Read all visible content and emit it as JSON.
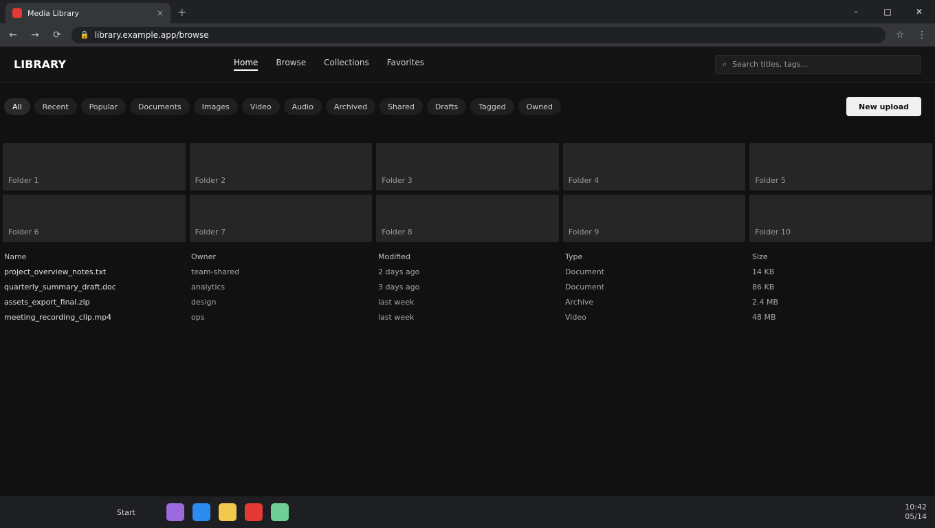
{
  "browser": {
    "tab_title": "Media Library",
    "tab_close": "×",
    "new_tab": "+",
    "win_min": "–",
    "win_max": "□",
    "win_close": "✕",
    "back": "←",
    "forward": "→",
    "reload": "⟳",
    "lock": "🔒",
    "url": "library.example.app/browse",
    "ext_star": "☆",
    "ext_menu": "⋮"
  },
  "app": {
    "logo": "LIBRARY",
    "nav": [
      "Home",
      "Browse",
      "Collections",
      "Favorites"
    ],
    "search_placeholder": "Search titles, tags…",
    "search_icon": "⌕"
  },
  "filters": {
    "chips": [
      "All",
      "Recent",
      "Popular",
      "Documents",
      "Images",
      "Video",
      "Audio",
      "Archived",
      "Shared",
      "Drafts",
      "Tagged",
      "Owned"
    ],
    "primary_button": "New upload"
  },
  "tiles": [
    {
      "label": "Folder 1"
    },
    {
      "label": "Folder 2"
    },
    {
      "label": "Folder 3"
    },
    {
      "label": "Folder 4"
    },
    {
      "label": "Folder 5"
    },
    {
      "label": "Folder 6"
    },
    {
      "label": "Folder 7"
    },
    {
      "label": "Folder 8"
    },
    {
      "label": "Folder 9"
    },
    {
      "label": "Folder 10"
    }
  ],
  "table": {
    "columns": [
      "Name",
      "Owner",
      "Modified",
      "Type",
      "Size"
    ],
    "rows": [
      [
        "project_overview_notes.txt",
        "team-shared",
        "2 days ago",
        "Document",
        "14 KB"
      ],
      [
        "quarterly_summary_draft.doc",
        "analytics",
        "3 days ago",
        "Document",
        "86 KB"
      ],
      [
        "assets_export_final.zip",
        "design",
        "last week",
        "Archive",
        "2.4 MB"
      ],
      [
        "meeting_recording_clip.mp4",
        "ops",
        "last week",
        "Video",
        "48 MB"
      ]
    ]
  },
  "taskbar": {
    "start": "Start",
    "icons": [
      {
        "name": "purple-app-icon",
        "color": "#9c6ade"
      },
      {
        "name": "blue-app-icon",
        "color": "#2d8cf0"
      },
      {
        "name": "yellow-app-icon",
        "color": "#f2c94c"
      },
      {
        "name": "red-app-icon",
        "color": "#e53935"
      },
      {
        "name": "green-app-icon",
        "color": "#6fcf97"
      }
    ],
    "time": "10:42",
    "date": "05/14"
  }
}
